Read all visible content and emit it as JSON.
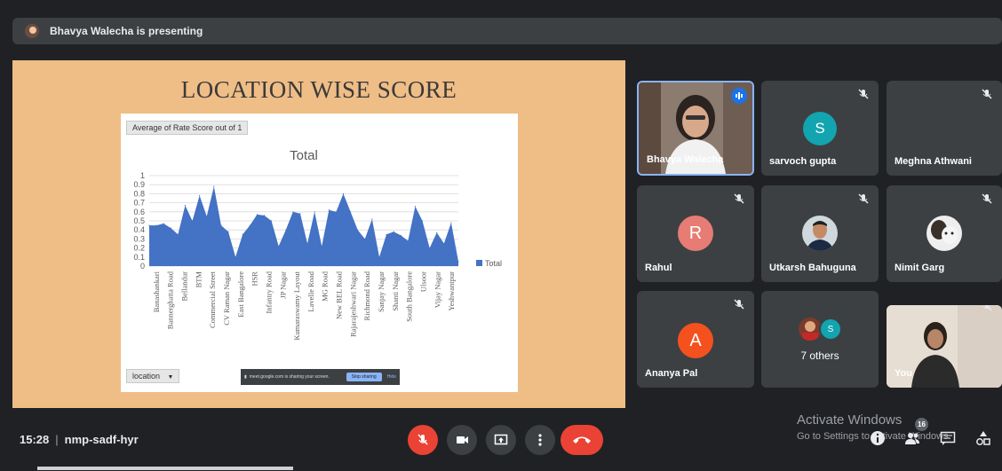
{
  "top_bar": {
    "presenter_text": "Bhavya Walecha is presenting"
  },
  "slide": {
    "title": "LOCATION WISE SCORE",
    "pivot_field_label": "Average of Rate Score out of 1",
    "location_filter_label": "location",
    "share_notice": {
      "message": "meet.google.com is sharing your screen.",
      "stop_label": "Stop sharing",
      "hide_label": "Hide"
    }
  },
  "chart_data": {
    "type": "area",
    "title": "Total",
    "series": [
      {
        "name": "Total",
        "color": "#4472c4",
        "values": [
          0.45,
          0.45,
          0.47,
          0.42,
          0.35,
          0.67,
          0.5,
          0.78,
          0.55,
          0.88,
          0.45,
          0.38,
          0.1,
          0.35,
          0.45,
          0.57,
          0.56,
          0.5,
          0.22,
          0.4,
          0.6,
          0.58,
          0.25,
          0.6,
          0.22,
          0.62,
          0.6,
          0.8,
          0.6,
          0.4,
          0.3,
          0.52,
          0.1,
          0.35,
          0.38,
          0.34,
          0.28,
          0.66,
          0.5,
          0.2,
          0.37,
          0.25,
          0.48,
          0.05
        ]
      }
    ],
    "x_tick_labels": [
      "Banashankari",
      "Bannerghatta Road",
      "Bellandur",
      "BTM",
      "Commercial Street",
      "CV Raman Nagar",
      "East Bangalore",
      "HSR",
      "Infantry Road",
      "JP Nagar",
      "Kumaraswamy Layout",
      "Lavelle Road",
      "MG Road",
      "New BEL Road",
      "Rajarajeshwari Nagar",
      "Richmond Road",
      "Sanjay Nagar",
      "Shanti Nagar",
      "South Bangalore",
      "Ulsoor",
      "Vijay Nagar",
      "Yeshwantpur"
    ],
    "y_tick_labels": [
      "1",
      "0.9",
      "0.8",
      "0.7",
      "0.6",
      "0.5",
      "0.4",
      "0.3",
      "0.2",
      "0.1",
      "0"
    ],
    "ylim": [
      0,
      1
    ],
    "grid": true,
    "legend_position": "right",
    "legend_label": "Total"
  },
  "participants": [
    {
      "name": "Bhavya Walecha",
      "kind": "video",
      "speaking": true
    },
    {
      "name": "sarvoch gupta",
      "initial": "S",
      "color": "#12a4af",
      "muted": true
    },
    {
      "name": "Meghna Athwani",
      "muted": true
    },
    {
      "name": "Rahul",
      "initial": "R",
      "color": "#e67c73",
      "muted": true
    },
    {
      "name": "Utkarsh Bahuguna",
      "kind": "photo",
      "muted": true
    },
    {
      "name": "Nimit Garg",
      "kind": "photo",
      "muted": true
    },
    {
      "name": "Ananya Pal",
      "initial": "A",
      "color": "#f4511e",
      "muted": true
    },
    {
      "name": "7 others",
      "small_initial": "S"
    },
    {
      "name": "You",
      "kind": "video",
      "muted": true
    }
  ],
  "bottom_bar": {
    "time": "15:28",
    "meeting_code": "nmp-sadf-hyr",
    "people_count": "16"
  },
  "watermark": {
    "line1": "Activate Windows",
    "line2": "Go to Settings to activate Windows."
  },
  "icons": [
    "mic-off-icon",
    "camera-icon",
    "present-screen-icon",
    "more-options-icon",
    "end-call-icon",
    "info-icon",
    "people-icon",
    "chat-icon",
    "activities-icon"
  ]
}
